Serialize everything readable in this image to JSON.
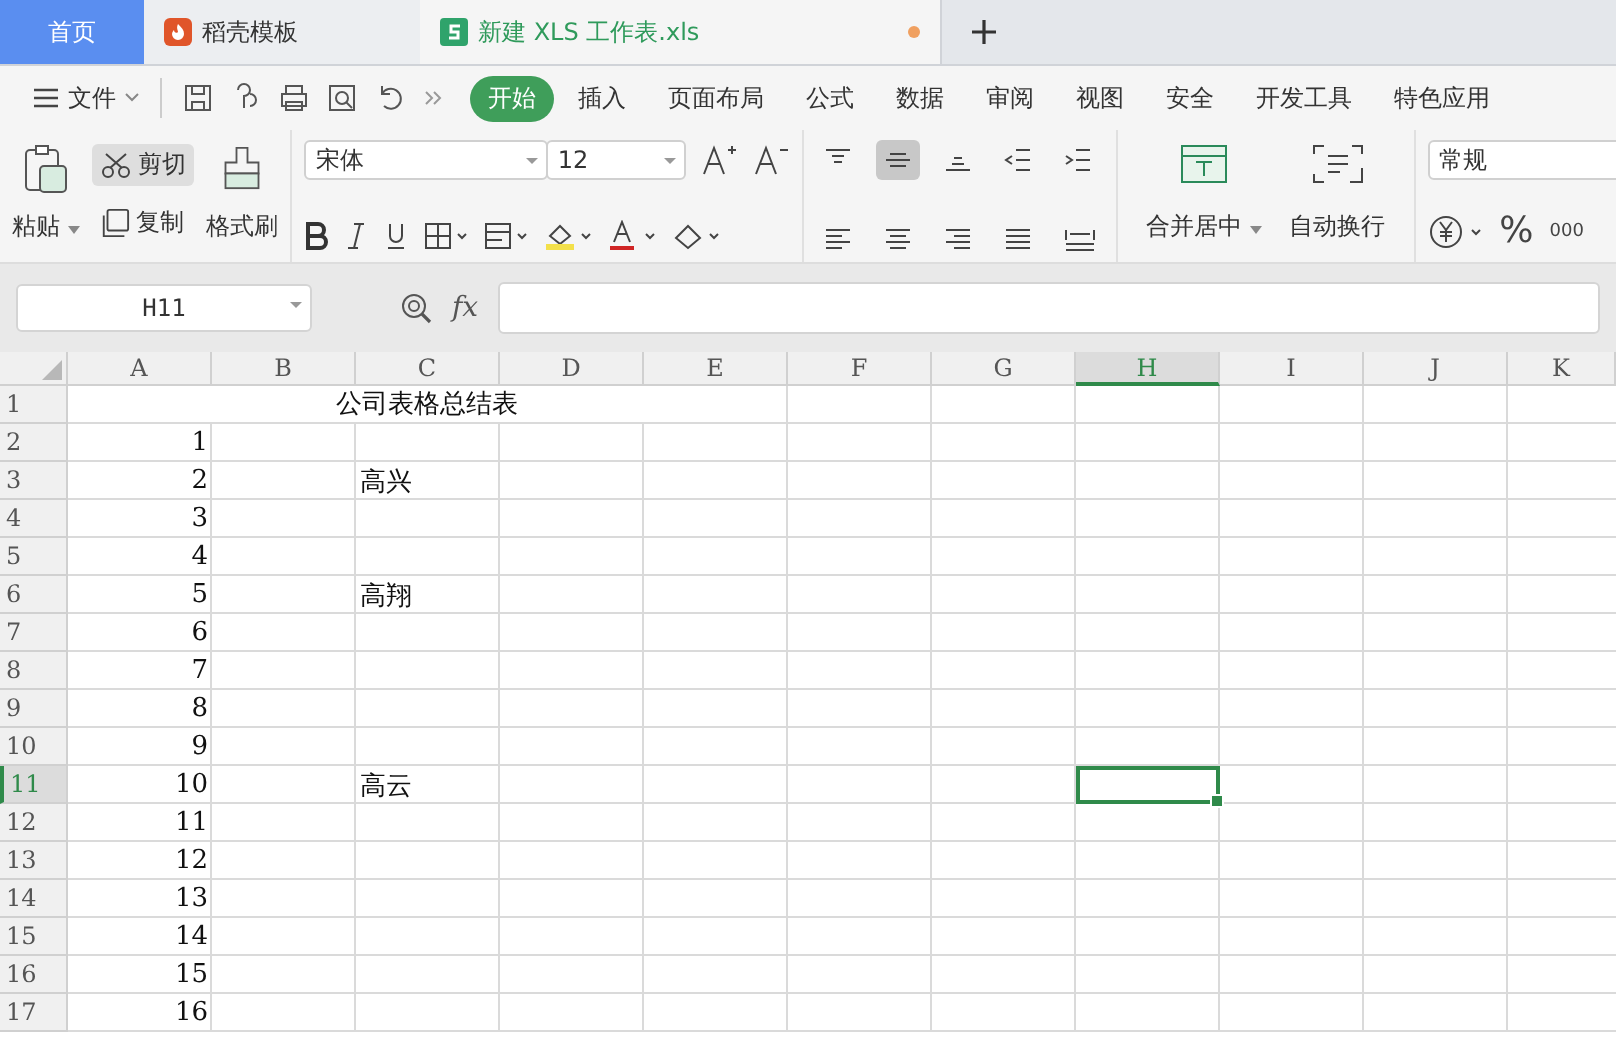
{
  "tabs": [
    {
      "label": "首页",
      "kind": "home",
      "selected": false
    },
    {
      "label": "稻壳模板",
      "kind": "docer",
      "selected": false
    },
    {
      "label": "新建 XLS 工作表.xls",
      "kind": "sheet",
      "selected": true,
      "unsaved": true
    }
  ],
  "menu": {
    "file": "文件",
    "ribbon_tabs": [
      {
        "label": "开始",
        "selected": true
      },
      {
        "label": "插入",
        "selected": false
      },
      {
        "label": "页面布局",
        "selected": false
      },
      {
        "label": "公式",
        "selected": false
      },
      {
        "label": "数据",
        "selected": false
      },
      {
        "label": "审阅",
        "selected": false
      },
      {
        "label": "视图",
        "selected": false
      },
      {
        "label": "安全",
        "selected": false
      },
      {
        "label": "开发工具",
        "selected": false
      },
      {
        "label": "特色应用",
        "selected": false
      }
    ]
  },
  "ribbon": {
    "paste": "粘贴",
    "cut": {
      "label": "剪切",
      "active": true
    },
    "copy": "复制",
    "format_painter": "格式刷",
    "font_name": "宋体",
    "font_size": "12",
    "align_buttons": [
      {
        "selected": false
      },
      {
        "selected": true
      },
      {
        "selected": false
      },
      {
        "selected": false
      },
      {
        "selected": false
      }
    ],
    "merge": "合并居中",
    "wrap": "自动换行",
    "number_format": "常规",
    "percent": "%",
    "thousands": "000"
  },
  "formula_bar": {
    "name_box": "H11",
    "fx": "fx"
  },
  "sheet": {
    "columns": [
      {
        "label": "A",
        "selected": false
      },
      {
        "label": "B",
        "selected": false
      },
      {
        "label": "C",
        "selected": false
      },
      {
        "label": "D",
        "selected": false
      },
      {
        "label": "E",
        "selected": false
      },
      {
        "label": "F",
        "selected": false
      },
      {
        "label": "G",
        "selected": false
      },
      {
        "label": "H",
        "selected": true
      },
      {
        "label": "I",
        "selected": false
      },
      {
        "label": "J",
        "selected": false
      },
      {
        "label": "K",
        "selected": false
      }
    ],
    "rows": [
      {
        "header": "1",
        "selected": false,
        "merged_title": "公司表格总结表"
      },
      {
        "header": "2",
        "selected": false,
        "a": "1"
      },
      {
        "header": "3",
        "selected": false,
        "a": "2",
        "c": "高兴"
      },
      {
        "header": "4",
        "selected": false,
        "a": "3"
      },
      {
        "header": "5",
        "selected": false,
        "a": "4"
      },
      {
        "header": "6",
        "selected": false,
        "a": "5",
        "c": "高翔"
      },
      {
        "header": "7",
        "selected": false,
        "a": "6"
      },
      {
        "header": "8",
        "selected": false,
        "a": "7"
      },
      {
        "header": "9",
        "selected": false,
        "a": "8"
      },
      {
        "header": "10",
        "selected": false,
        "a": "9"
      },
      {
        "header": "11",
        "selected": true,
        "a": "10",
        "c": "高云"
      },
      {
        "header": "12",
        "selected": false,
        "a": "11"
      },
      {
        "header": "13",
        "selected": false,
        "a": "12"
      },
      {
        "header": "14",
        "selected": false,
        "a": "13"
      },
      {
        "header": "15",
        "selected": false,
        "a": "14"
      },
      {
        "header": "16",
        "selected": false,
        "a": "15"
      },
      {
        "header": "17",
        "selected": false,
        "a": "16"
      }
    ]
  }
}
